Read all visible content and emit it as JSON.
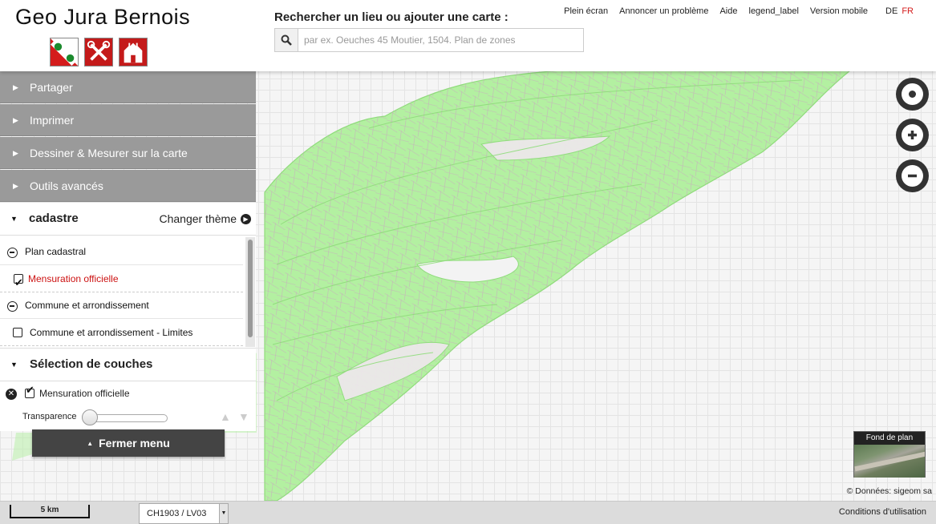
{
  "header": {
    "brand": "Geo Jura Bernois",
    "crests": [
      "crest-1",
      "crest-2",
      "crest-3"
    ],
    "search_label": "Rechercher un lieu ou ajouter une carte :",
    "search_placeholder": "par ex. Oeuches 45 Moutier, 1504. Plan de zones",
    "links": [
      "Plein écran",
      "Annoncer un problème",
      "Aide",
      "legend_label",
      "Version mobile"
    ],
    "lang_de": "DE",
    "lang_fr": "FR"
  },
  "sidebar": {
    "accordion": [
      "Partager",
      "Imprimer",
      "Dessiner & Mesurer sur la carte",
      "Outils avancés"
    ],
    "theme_title": "cadastre",
    "change_theme": "Changer thème",
    "tree": {
      "group1": "Plan cadastral",
      "layer1": "Mensuration officielle",
      "group2": "Commune et arrondissement",
      "layer2": "Commune et arrondissement - Limites"
    },
    "selection_title": "Sélection de couches",
    "selected_layer": "Mensuration officielle",
    "transparency_label": "Transparence",
    "close_menu": "Fermer menu"
  },
  "map": {
    "basemap_label": "Fond de plan",
    "attribution": "©  Données: sigeom sa",
    "colors": {
      "terrain": "#b3f0a1",
      "terrain_stroke": "#8fdc7b",
      "accent_red": "#cc1111"
    }
  },
  "footer": {
    "scale": "5 km",
    "projection": "CH1903 / LV03",
    "terms": "Conditions d'utilisation"
  }
}
